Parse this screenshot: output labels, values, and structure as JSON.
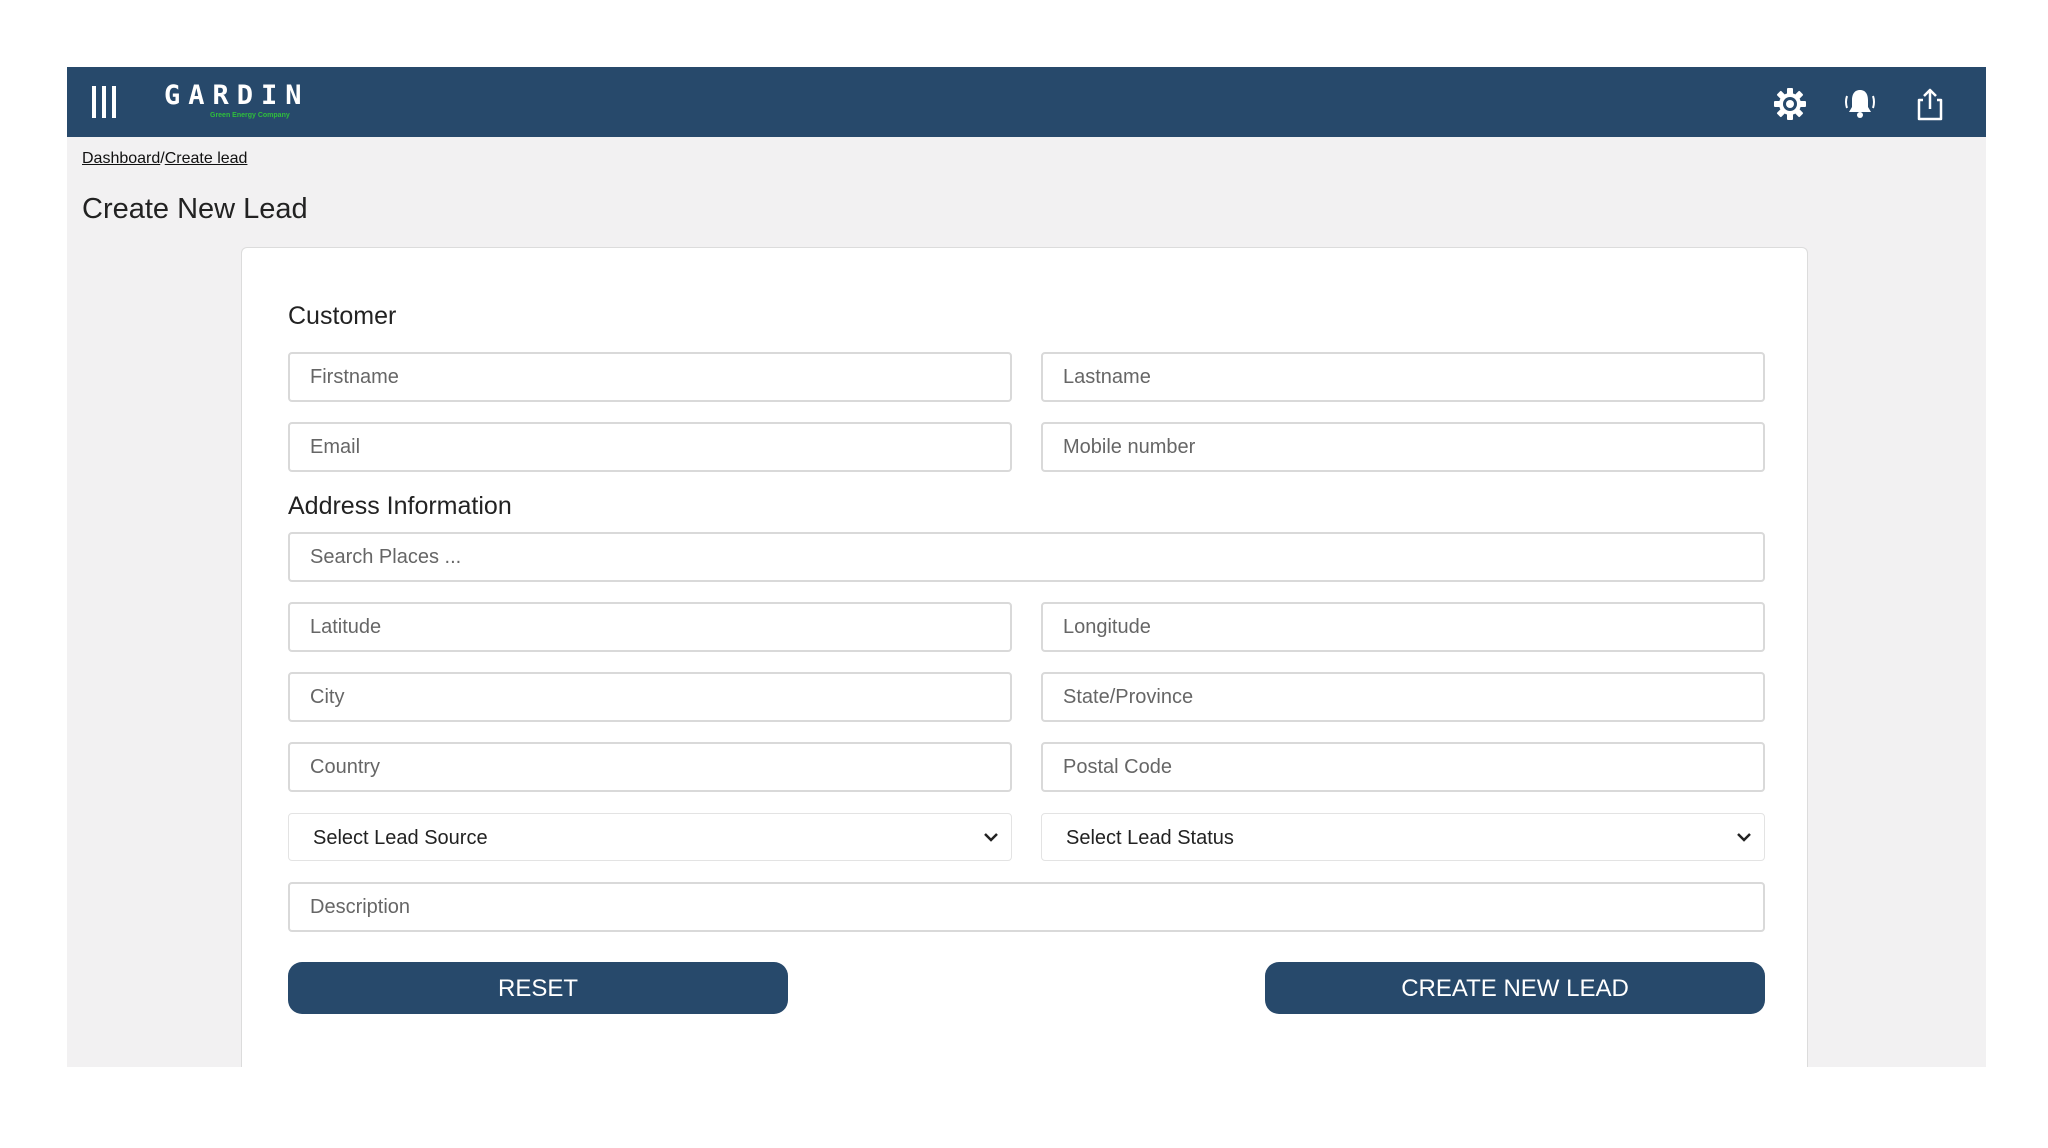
{
  "header": {
    "logo_title": "GARDIN",
    "logo_tagline": "Green Energy Company",
    "icons": [
      "menu-icon",
      "gear-icon",
      "bell-icon",
      "share-icon"
    ]
  },
  "breadcrumb": {
    "dashboard": "Dashboard",
    "separator": "/",
    "current": "Create lead"
  },
  "page_title": "Create New Lead",
  "customer": {
    "title": "Customer",
    "firstname_placeholder": "Firstname",
    "lastname_placeholder": "Lastname",
    "email_placeholder": "Email",
    "mobile_placeholder": "Mobile number"
  },
  "address": {
    "title": "Address Information",
    "search_placeholder": "Search Places ...",
    "latitude_placeholder": "Latitude",
    "longitude_placeholder": "Longitude",
    "city_placeholder": "City",
    "state_placeholder": "State/Province",
    "country_placeholder": "Country",
    "postal_placeholder": "Postal Code"
  },
  "lead_source_select": "Select Lead Source",
  "lead_status_select": "Select Lead Status",
  "description_placeholder": "Description",
  "buttons": {
    "reset": "RESET",
    "create": "CREATE NEW LEAD"
  },
  "colors": {
    "primary": "#27496b",
    "page_bg": "#f2f1f2",
    "logo_green": "#2fbf3b"
  }
}
